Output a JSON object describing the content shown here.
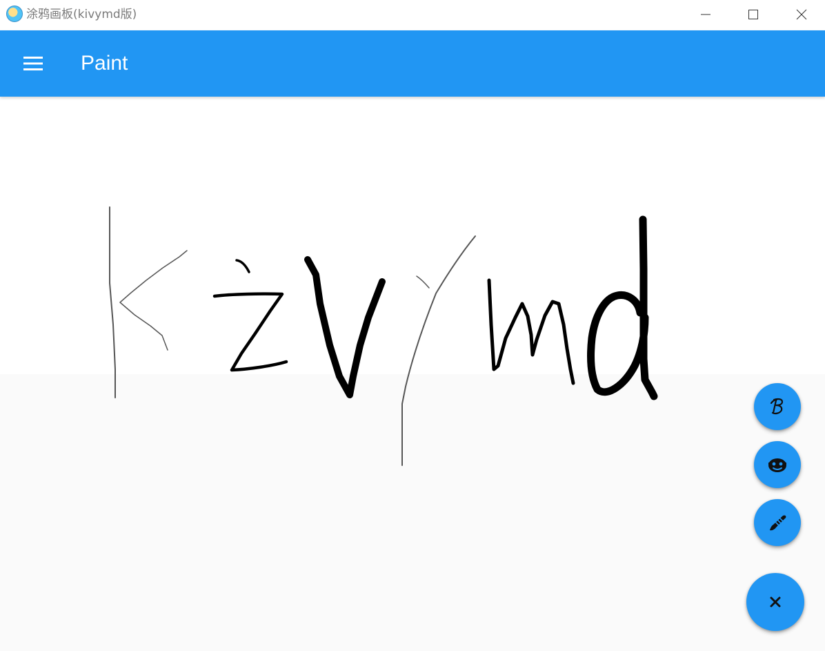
{
  "window": {
    "title": "涂鸦画板(kivymd版)",
    "icon": "paint-brush-app-icon",
    "controls": [
      "minimize-icon",
      "maximize-icon",
      "close-icon"
    ]
  },
  "appbar": {
    "title": "Paint",
    "menu_icon": "hamburger-menu-icon",
    "color": "#2196f3"
  },
  "canvas": {
    "drawing_text": "kżvymd",
    "stroke_color": "#000000"
  },
  "speed_dial": {
    "actions": [
      {
        "icon": "pen-b-icon"
      },
      {
        "icon": "face-icon"
      },
      {
        "icon": "brush-icon"
      }
    ],
    "main_icon": "close-icon",
    "color": "#2196f3"
  }
}
